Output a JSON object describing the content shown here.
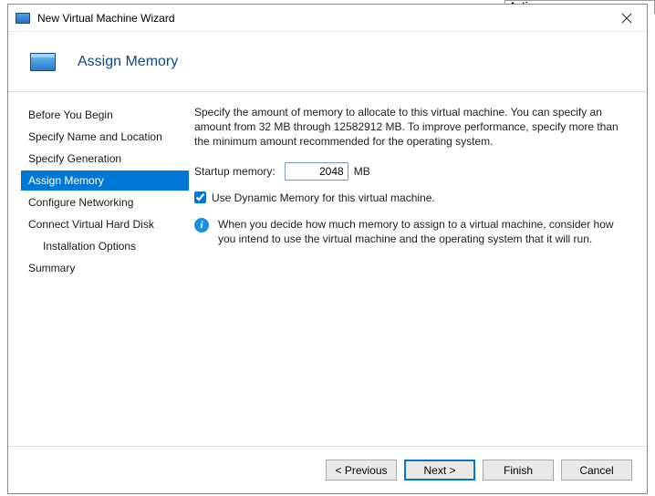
{
  "background": {
    "actions_header": "Actions"
  },
  "titlebar": {
    "title": "New Virtual Machine Wizard"
  },
  "header": {
    "title": "Assign Memory"
  },
  "sidebar": {
    "steps": [
      {
        "label": "Before You Begin"
      },
      {
        "label": "Specify Name and Location"
      },
      {
        "label": "Specify Generation"
      },
      {
        "label": "Assign Memory"
      },
      {
        "label": "Configure Networking"
      },
      {
        "label": "Connect Virtual Hard Disk"
      },
      {
        "label": "Installation Options"
      },
      {
        "label": "Summary"
      }
    ]
  },
  "content": {
    "description": "Specify the amount of memory to allocate to this virtual machine. You can specify an amount from 32 MB through 12582912 MB. To improve performance, specify more than the minimum amount recommended for the operating system.",
    "startup_label": "Startup memory:",
    "startup_value": "2048",
    "startup_unit": "MB",
    "dynamic_label": "Use Dynamic Memory for this virtual machine.",
    "info_text": "When you decide how much memory to assign to a virtual machine, consider how you intend to use the virtual machine and the operating system that it will run."
  },
  "footer": {
    "previous": "< Previous",
    "next": "Next >",
    "finish": "Finish",
    "cancel": "Cancel"
  }
}
